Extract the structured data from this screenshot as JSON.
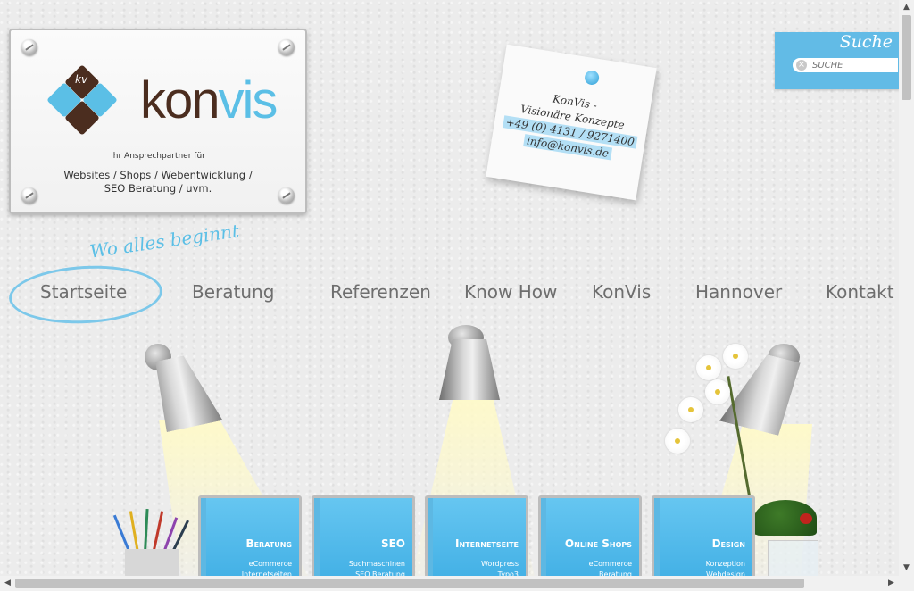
{
  "logo": {
    "monogram": "kv",
    "brand_main": "kon",
    "brand_accent": "vis",
    "tagline": "Ihr Ansprechpartner für",
    "services_line1": "Websites / Shops / Webentwicklung /",
    "services_line2": "SEO Beratung / uvm."
  },
  "note": {
    "line1": "KonVis -",
    "line2": "Visionäre Konzepte",
    "phone": "+49 (0) 4131 / 9271400",
    "email": "info@konvis.de"
  },
  "search": {
    "title": "Suche",
    "placeholder": "SUCHE",
    "clear_glyph": "×"
  },
  "nav": {
    "tagline": "Wo alles beginnt",
    "items": [
      "Startseite",
      "Beratung",
      "Referenzen",
      "Know How",
      "KonVis",
      "Hannover",
      "Kontakt"
    ],
    "active": "Startseite"
  },
  "books": [
    {
      "title": "Beratung",
      "sub1": "eCommerce",
      "sub2": "Internetseiten"
    },
    {
      "title": "SEO",
      "sub1": "Suchmaschinen",
      "sub2": "SEO Beratung"
    },
    {
      "title": "Internetseite",
      "sub1": "Wordpress",
      "sub2": "Typo3"
    },
    {
      "title": "Online Shops",
      "sub1": "eCommerce",
      "sub2": "Beratung"
    },
    {
      "title": "Design",
      "sub1": "Konzeption",
      "sub2": "Webdesign"
    }
  ],
  "scrollbars": {
    "up": "▲",
    "down": "▼",
    "left": "◀",
    "right": "▶"
  },
  "colors": {
    "accent": "#5bbfe6",
    "brand_brown": "#4b2d1f",
    "book_blue": "#3faee4",
    "nav_text": "#6e6e6e"
  }
}
